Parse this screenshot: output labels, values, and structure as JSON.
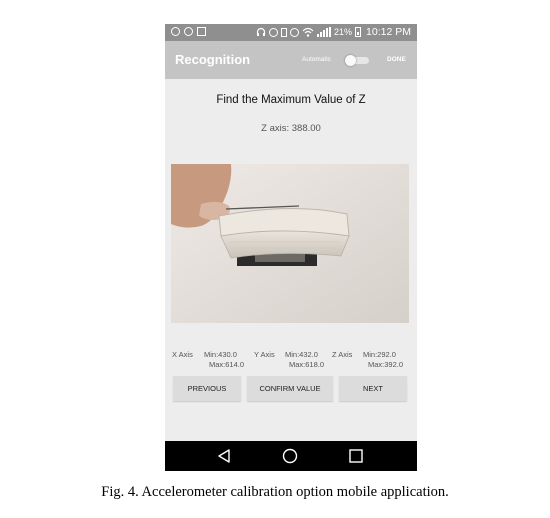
{
  "status_bar": {
    "battery": "21%",
    "time": "10:12 PM",
    "icons": [
      "spotify-icon",
      "whatsapp-icon",
      "image-icon",
      "headphones-icon",
      "bluetooth-icon",
      "vibrate-icon",
      "alarm-icon",
      "wifi-icon",
      "signal-icon",
      "battery-icon"
    ]
  },
  "app_bar": {
    "title": "Recognition",
    "automatic_label": "Automatic",
    "automatic_on": false,
    "done_label": "DONE"
  },
  "main": {
    "heading": "Find the Maximum Value of Z",
    "z_axis_readout": "Z axis: 388.00"
  },
  "axes": [
    {
      "label": "X Axis",
      "min": "Min:430.0",
      "max": "Max:614.0"
    },
    {
      "label": "Y Axis",
      "min": "Min:432.0",
      "max": "Max:618.0"
    },
    {
      "label": "Z Axis",
      "min": "Min:292.0",
      "max": "Max:392.0"
    }
  ],
  "buttons": {
    "previous": "PREVIOUS",
    "confirm": "CONFIRM VALUE",
    "next": "NEXT"
  },
  "nav": [
    "back-icon",
    "home-icon",
    "recents-icon"
  ],
  "caption": "Fig. 4.   Accelerometer calibration option mobile application.",
  "colors": {
    "status_bar": "#8f8f8f",
    "app_bar": "#c4c4c4",
    "screen_bg": "#ededed",
    "button_bg": "#dcdcdc",
    "nav_bar": "#000000"
  }
}
